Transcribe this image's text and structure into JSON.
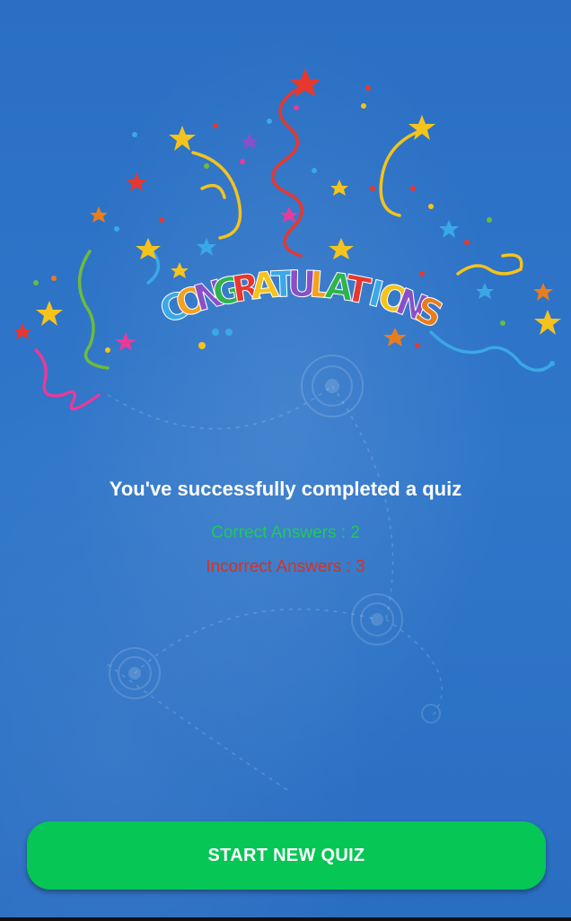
{
  "banner": {
    "word": "CONGRATULATIONS",
    "letter_colors": [
      "#3aa8e6",
      "#f4a21c",
      "#8a4fc7",
      "#2fb34f",
      "#e6382f",
      "#f4c31c",
      "#3aa8e6",
      "#8a4fc7",
      "#f4a21c",
      "#2fb34f",
      "#e6382f",
      "#3aa8e6",
      "#f4c31c",
      "#8a4fc7",
      "#e87d1e"
    ]
  },
  "result": {
    "headline": "You've successfully completed a quiz",
    "correct": "Correct Answers : 2",
    "incorrect": "Incorrect Answers : 3"
  },
  "actions": {
    "start_new_quiz": "START NEW QUIZ"
  },
  "colors": {
    "background": "#2d73c6",
    "correct": "#1ec95a",
    "incorrect": "#d9311e",
    "button": "#06c655"
  }
}
